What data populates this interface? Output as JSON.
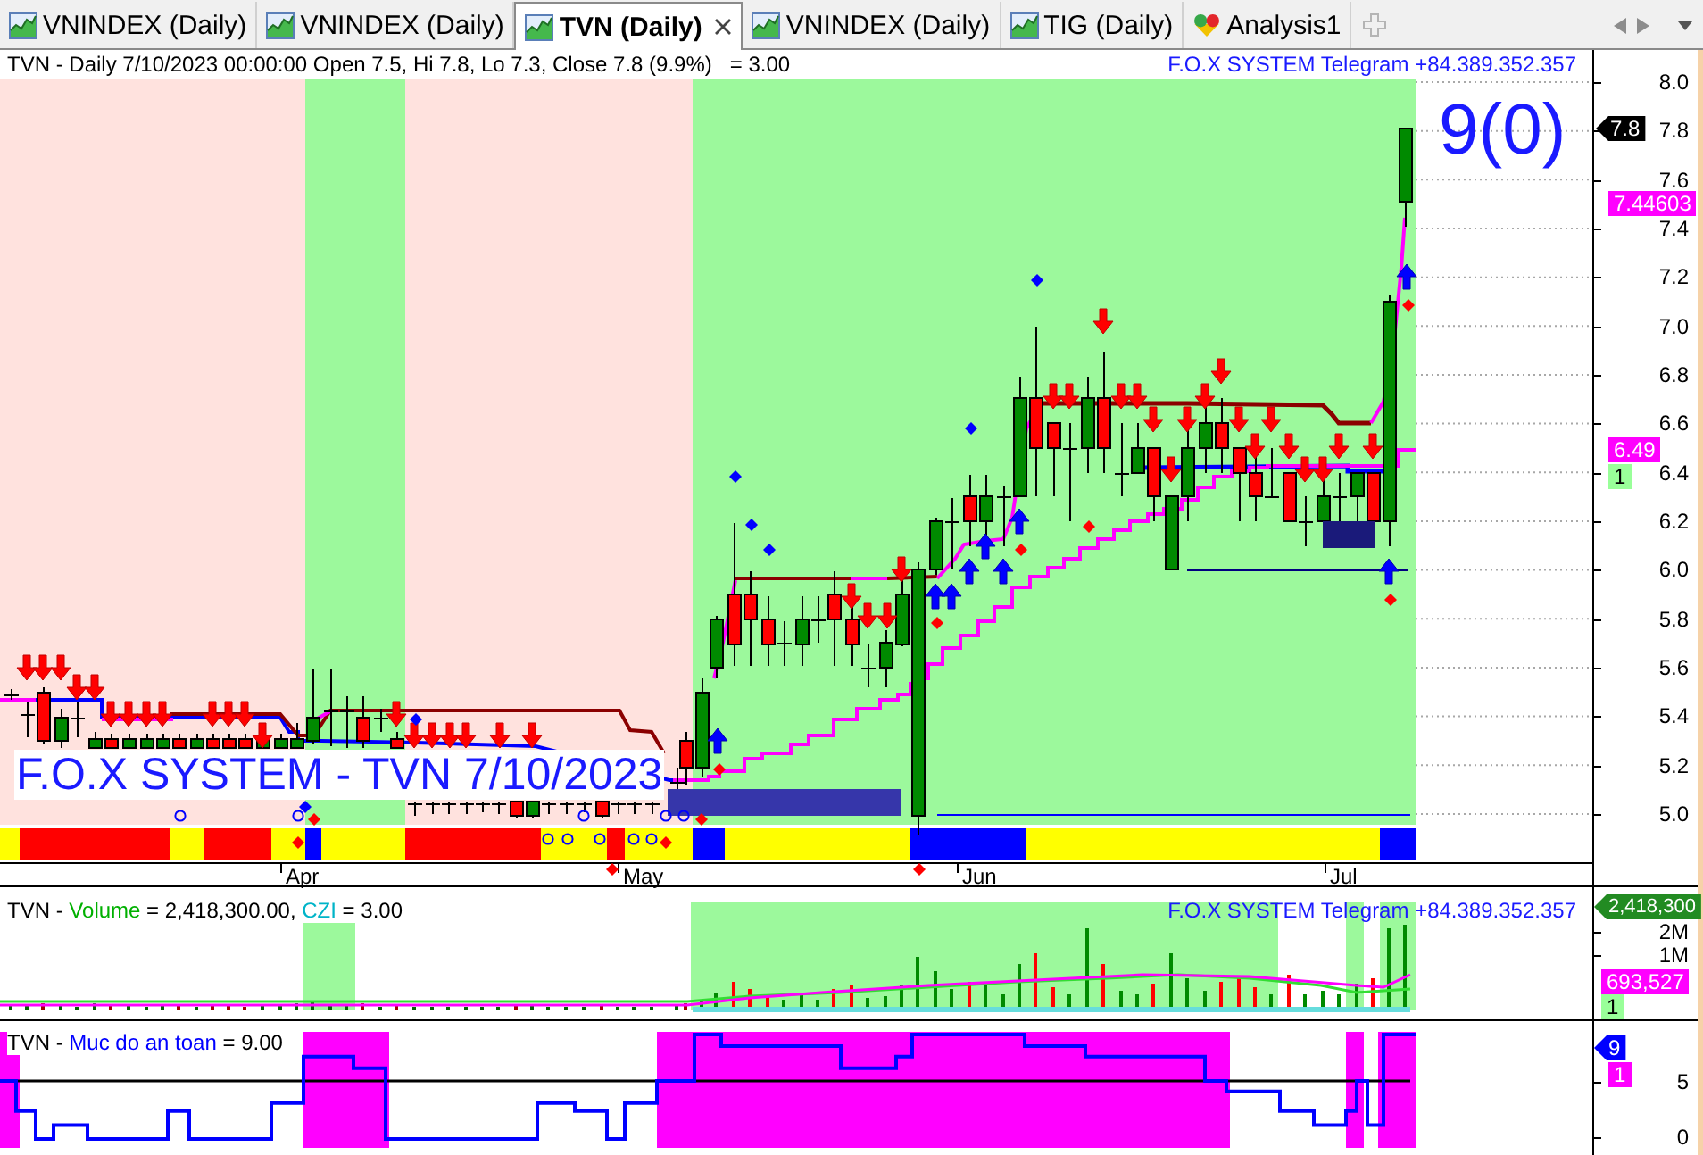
{
  "tabs": [
    {
      "label": "VNINDEX (Daily)",
      "kind": "chart",
      "selected": false
    },
    {
      "label": "VNINDEX (Daily)",
      "kind": "chart",
      "selected": false
    },
    {
      "label": "TVN (Daily)",
      "kind": "chart",
      "selected": true
    },
    {
      "label": "VNINDEX (Daily)",
      "kind": "chart",
      "selected": false
    },
    {
      "label": "TIG (Daily)",
      "kind": "chart",
      "selected": false
    },
    {
      "label": "Analysis1",
      "kind": "analysis",
      "selected": false
    }
  ],
  "price_panel": {
    "header": "TVN - Daily 7/10/2023 00:00:00 Open 7.5, Hi 7.8, Lo 7.3, Close 7.8 (9.9%)   = 3.00",
    "contact": "F.O.X SYSTEM Telegram +84.389.352.357",
    "signal_count": "9(0)",
    "overlay_title": "F.O.X SYSTEM - TVN 7/10/2023",
    "y_ticks": [
      "8.0",
      "7.8",
      "7.6",
      "7.4",
      "7.2",
      "7.0",
      "6.8",
      "6.6",
      "6.4",
      "6.2",
      "6.0",
      "5.8",
      "5.6",
      "5.4",
      "5.2",
      "5.0"
    ],
    "x_ticks": [
      "Apr",
      "May",
      "Jun",
      "Jul"
    ],
    "value_tags": [
      {
        "text": "7.8",
        "kind": "pointer",
        "color": "#000000"
      },
      {
        "text": "7.44603",
        "kind": "box",
        "color": "#ff00ff"
      },
      {
        "text": "6.49",
        "kind": "box",
        "color": "#ff00ff"
      },
      {
        "text": "1",
        "kind": "box",
        "color": "#99ff99"
      }
    ]
  },
  "volume_panel": {
    "header": [
      {
        "text": "TVN - ",
        "color": "#000000"
      },
      {
        "text": "Volume",
        "color": "#00b000"
      },
      {
        "text": " = 2,418,300.00, ",
        "color": "#000000"
      },
      {
        "text": "CZI",
        "color": "#00b4c8"
      },
      {
        "text": " = 3.00",
        "color": "#000000"
      }
    ],
    "contact": "F.O.X SYSTEM Telegram +84.389.352.357",
    "y_ticks": [
      "2M",
      "1M"
    ],
    "value_tags": [
      {
        "text": "2,418,300",
        "kind": "pointer",
        "color": "#228b22"
      },
      {
        "text": "693,527",
        "kind": "box",
        "color": "#ff00ff"
      },
      {
        "text": "1",
        "kind": "box",
        "color": "#99ff99"
      }
    ]
  },
  "safety_panel": {
    "header": [
      {
        "text": "TVN - ",
        "color": "#000000"
      },
      {
        "text": "Muc do an toan",
        "color": "#0000ff"
      },
      {
        "text": " = 9.00",
        "color": "#000000"
      }
    ],
    "y_ticks": [
      "5",
      "0"
    ],
    "value_tags": [
      {
        "text": "9",
        "kind": "pointer",
        "color": "#0000ff"
      },
      {
        "text": "1",
        "kind": "box",
        "color": "#ff00ff"
      }
    ]
  }
}
